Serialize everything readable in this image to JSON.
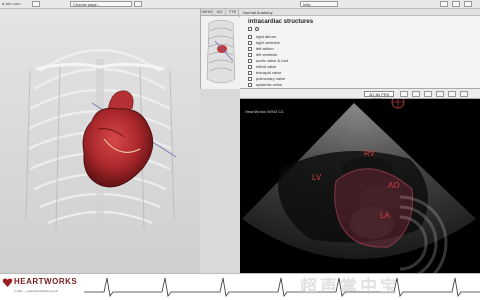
{
  "topbar": {
    "app_logo_text": "● site.com",
    "dropdown_label": "Choose page...",
    "right_box_label": "help"
  },
  "thumbnail": {
    "tabs": [
      "VIEW",
      "XO",
      "TTE"
    ]
  },
  "structures": {
    "header": "Normal Anatomy",
    "title": "intracardiac structures",
    "items": [
      "right atrium",
      "right ventricle",
      "left atrium",
      "left ventricle",
      "aortic valve & root",
      "mitral valve",
      "tricuspid valve",
      "pulmonary valve",
      "systemic veins"
    ]
  },
  "echo": {
    "mode_label": "2D 3D FR3 CW3 ✓",
    "info": "HeartWorks W/N3 C3",
    "labels": {
      "rv": "RV",
      "lv": "LV",
      "ao": "AO",
      "la": "LA"
    }
  },
  "brand": {
    "name": "HEARTWORKS",
    "url": "© IHS — www.heartworks.me.uk"
  },
  "watermark": "超声掌中宝",
  "colors": {
    "heart": "#a8272b",
    "brand": "#7a1e1e",
    "annotation": "#d04040"
  }
}
